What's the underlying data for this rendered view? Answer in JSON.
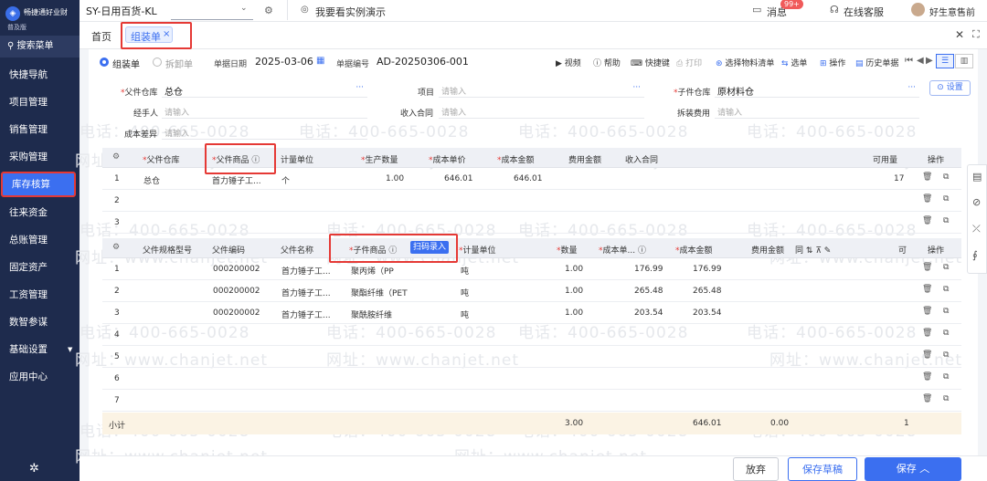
{
  "sidebar": {
    "brand_name": "畅捷通好业财",
    "brand_edition": "普及版",
    "search_label": "搜索菜单",
    "items": [
      "快捷导航",
      "项目管理",
      "销售管理",
      "采购管理",
      "库存核算",
      "往来资金",
      "总账管理",
      "固定资产",
      "工资管理",
      "数智参谋",
      "基础设置",
      "应用中心"
    ],
    "active_index": 4
  },
  "topbar": {
    "account": "SY-日用百货-KL",
    "demo_link": "我要看实例演示",
    "messages": "消息",
    "message_badge": "99+",
    "service": "在线客服",
    "user": "好生意售前"
  },
  "tabs": {
    "home": "首页",
    "current": "组装单",
    "close_mark": "×"
  },
  "form_toolbar": {
    "mode_assemble": "组装单",
    "mode_disassemble": "拆卸单",
    "date_label": "单据日期",
    "date_value": "2025-03-06",
    "number_label": "单据编号",
    "number_value": "AD-20250306-001",
    "actions": [
      "视频",
      "帮助",
      "快捷键",
      "打印",
      "选择物料清单",
      "选单",
      "操作",
      "历史单据"
    ]
  },
  "header_fields": {
    "parent_wh_label": "父件仓库",
    "parent_wh_value": "总仓",
    "project_label": "项目",
    "project_placeholder": "请输入",
    "child_wh_label": "子件仓库",
    "child_wh_value": "原材料仓",
    "settings_label": "设置",
    "handler_label": "经手人",
    "handler_placeholder": "请输入",
    "contract_label": "收入合同",
    "contract_placeholder": "请输入",
    "dismantle_label": "拆装费用",
    "dismantle_placeholder": "请输入",
    "cost_diff_label": "成本差异",
    "cost_diff_placeholder": "请输入"
  },
  "parent_table": {
    "headers": [
      "父件仓库",
      "父件商品",
      "计量单位",
      "生产数量",
      "成本单价",
      "成本金额",
      "费用金额",
      "收入合同",
      "可用量",
      "操作"
    ],
    "rows": [
      {
        "no": "1",
        "wh": "总仓",
        "product": "首力锤子工...",
        "unit": "个",
        "qty": "1.00",
        "price": "646.01",
        "amount": "646.01",
        "available": "17"
      },
      {
        "no": "2"
      },
      {
        "no": "3"
      }
    ]
  },
  "child_table": {
    "headers": [
      "父件规格型号",
      "父件编码",
      "父件名称",
      "子件商品",
      "扫码录入",
      "计量单位",
      "数量",
      "成本单...",
      "成本金额",
      "费用金额",
      "同",
      "可",
      "操作"
    ],
    "rows": [
      {
        "no": "1",
        "code": "000200002",
        "name": "首力锤子工...",
        "product": "聚丙烯（PP",
        "unit": "吨",
        "qty": "1.00",
        "price": "176.99",
        "amount": "176.99"
      },
      {
        "no": "2",
        "code": "000200002",
        "name": "首力锤子工...",
        "product": "聚酯纤维（PET",
        "unit": "吨",
        "qty": "1.00",
        "price": "265.48",
        "amount": "265.48"
      },
      {
        "no": "3",
        "code": "000200002",
        "name": "首力锤子工...",
        "product": "聚酰胺纤维",
        "unit": "吨",
        "qty": "1.00",
        "price": "203.54",
        "amount": "203.54"
      },
      {
        "no": "4"
      },
      {
        "no": "5"
      },
      {
        "no": "6"
      },
      {
        "no": "7"
      }
    ],
    "subtotal_label": "小计",
    "subtotal_qty": "3.00",
    "subtotal_amount": "646.01",
    "subtotal_fee": "0.00",
    "subtotal_right": "1"
  },
  "footer": {
    "discard": "放弃",
    "save_draft": "保存草稿",
    "save": "保存"
  },
  "watermark": {
    "phone": "电话：400-665-0028",
    "site": "网址：www.chanjet.net"
  }
}
